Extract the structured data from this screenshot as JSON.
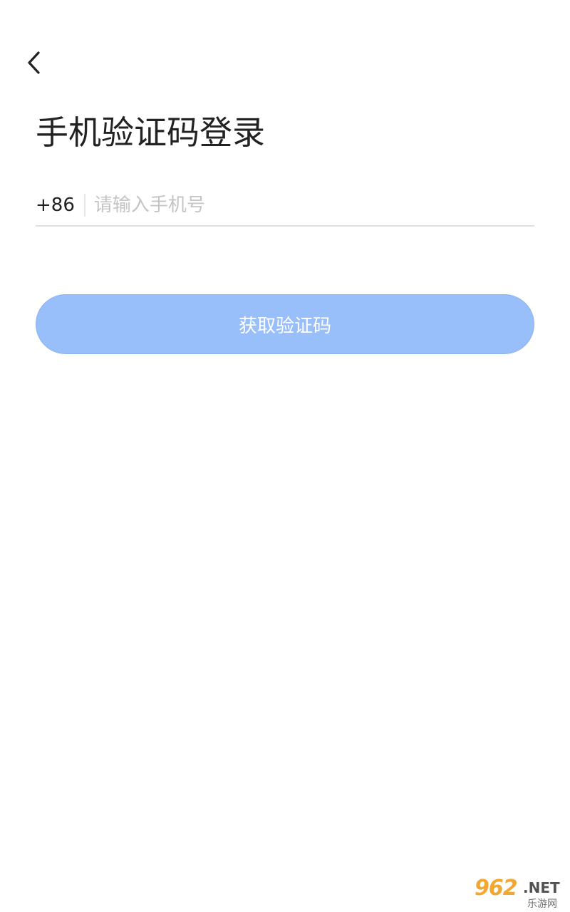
{
  "header": {
    "back_icon": "chevron-left-icon"
  },
  "page": {
    "title": "手机验证码登录"
  },
  "phone_field": {
    "country_code": "+86",
    "placeholder": "请输入手机号",
    "value": ""
  },
  "actions": {
    "get_code_label": "获取验证码"
  },
  "colors": {
    "button_bg": "#99bffa",
    "button_text": "#ffffff",
    "placeholder": "#c4c4c4",
    "divider": "#e0e0e0"
  },
  "watermark": {
    "main": "962",
    "suffix": ".NET",
    "sub": "乐游网"
  }
}
